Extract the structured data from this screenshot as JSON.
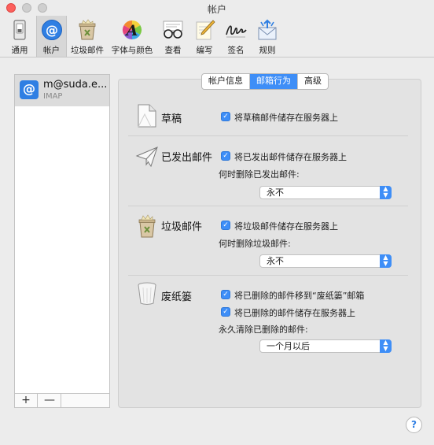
{
  "window": {
    "title": "帐户"
  },
  "toolbar": {
    "items": [
      {
        "label": "通用",
        "icon": "general-switch-icon"
      },
      {
        "label": "帐户",
        "icon": "at-sign-icon",
        "active": true
      },
      {
        "label": "垃圾邮件",
        "icon": "junk-bin-icon"
      },
      {
        "label": "字体与颜色",
        "icon": "font-color-wheel-icon"
      },
      {
        "label": "查看",
        "icon": "glasses-icon"
      },
      {
        "label": "编写",
        "icon": "compose-pencil-icon"
      },
      {
        "label": "签名",
        "icon": "signature-icon"
      },
      {
        "label": "规则",
        "icon": "rules-envelope-icon"
      }
    ]
  },
  "sidebar": {
    "account": {
      "name": "m@suda.e...",
      "type": "IMAP"
    },
    "add_label": "+",
    "remove_label": "—"
  },
  "tabs": [
    {
      "label": "帐户信息"
    },
    {
      "label": "邮箱行为",
      "selected": true
    },
    {
      "label": "高级"
    }
  ],
  "sections": {
    "drafts": {
      "title": "草稿",
      "store_on_server": "将草稿邮件储存在服务器上"
    },
    "sent": {
      "title": "已发出邮件",
      "store_on_server": "将已发出邮件储存在服务器上",
      "delete_label": "何时删除已发出邮件:",
      "delete_value": "永不"
    },
    "junk": {
      "title": "垃圾邮件",
      "store_on_server": "将垃圾邮件储存在服务器上",
      "delete_label": "何时删除垃圾邮件:",
      "delete_value": "永不"
    },
    "trash": {
      "title": "废纸篓",
      "move_to_trash": "将已删除的邮件移到“废纸篓”邮箱",
      "store_on_server": "将已删除的邮件储存在服务器上",
      "erase_label": "永久清除已删除的邮件:",
      "erase_value": "一个月以后"
    }
  },
  "help": {
    "label": "?"
  },
  "colors": {
    "accent": "#3e8ef7",
    "close": "#fc605c"
  }
}
